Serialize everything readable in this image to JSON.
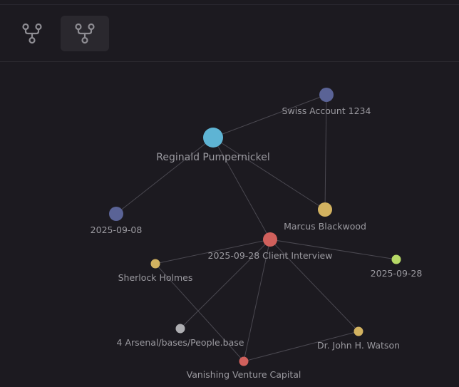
{
  "toolbar": {
    "buttons": [
      {
        "icon": "graph-view-icon",
        "active": false
      },
      {
        "icon": "graph-view-icon",
        "active": true
      }
    ]
  },
  "colors": {
    "background": "#1c1a20",
    "edge": "#4a4850",
    "label": "#9b9aa0",
    "node_blue": "#5a6396",
    "node_cyan": "#5eb4d4",
    "node_gold": "#d2b260",
    "node_red": "#d0605c",
    "node_green": "#b6d866",
    "node_gray": "#aeaeb2"
  },
  "graph": {
    "nodes": [
      {
        "id": "swiss",
        "label": "Swiss Account 1234",
        "color": "#5a6396"
      },
      {
        "id": "reginald",
        "label": "Reginald Pumpernickel",
        "color": "#5eb4d4"
      },
      {
        "id": "d0908",
        "label": "2025-09-08",
        "color": "#5a6396"
      },
      {
        "id": "marcus",
        "label": "Marcus Blackwood",
        "color": "#d2b260"
      },
      {
        "id": "interview",
        "label": "2025-09-28 Client Interview",
        "color": "#d0605c"
      },
      {
        "id": "sherlock",
        "label": "Sherlock Holmes",
        "color": "#d2b260"
      },
      {
        "id": "d0928",
        "label": "2025-09-28",
        "color": "#b6d866"
      },
      {
        "id": "arsenal",
        "label": "4 Arsenal/bases/People.base",
        "color": "#aeaeb2"
      },
      {
        "id": "watson",
        "label": "Dr. John H. Watson",
        "color": "#d2b260"
      },
      {
        "id": "vvc",
        "label": "Vanishing Venture Capital",
        "color": "#d0605c"
      }
    ],
    "edges": [
      [
        "reginald",
        "swiss"
      ],
      [
        "swiss",
        "marcus"
      ],
      [
        "reginald",
        "d0908"
      ],
      [
        "reginald",
        "marcus"
      ],
      [
        "reginald",
        "interview"
      ],
      [
        "interview",
        "sherlock"
      ],
      [
        "interview",
        "d0928"
      ],
      [
        "interview",
        "arsenal"
      ],
      [
        "interview",
        "vvc"
      ],
      [
        "interview",
        "watson"
      ],
      [
        "sherlock",
        "vvc"
      ],
      [
        "vvc",
        "watson"
      ]
    ]
  }
}
